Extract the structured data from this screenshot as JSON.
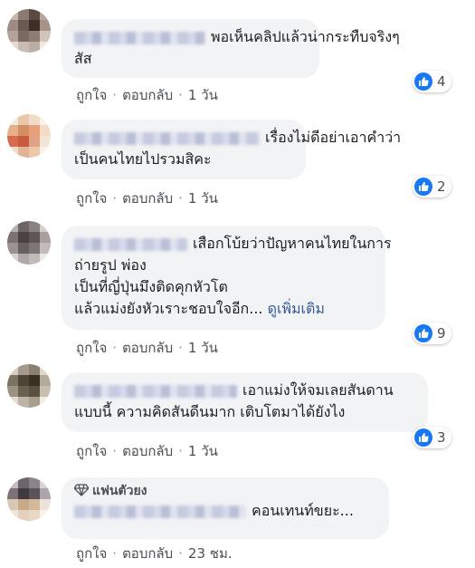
{
  "colors": {
    "like_blue": "#1877f2",
    "bubble_bg": "#f2f3f5",
    "link": "#385898"
  },
  "comments": [
    {
      "line1": "พอเห็นคลิปแล้วน่ากระทืบจริงๆ",
      "line2": "สัส",
      "like": "ถูกใจ",
      "reply": "ตอบกลับ",
      "time": "1 วัน",
      "reactions": "4",
      "avatar": [
        "#c8b8ac",
        "#8a7a72",
        "#5a4a44",
        "#b8a69c",
        "#9c8c84",
        "#6b5a52",
        "#3e2e28",
        "#a6948a",
        "#b4a296",
        "#7a6a62",
        "#8c7c72",
        "#d2c4ba",
        "#e4dad2",
        "#c8bcb4",
        "#bcaea4",
        "#f0e8e2"
      ]
    },
    {
      "line1": "เรื่องไม่ดีอย่าเอาคำว่า",
      "line2": "เป็นคนไทยไปรวมสิคะ",
      "like": "ถูกใจ",
      "reply": "ตอบกลับ",
      "time": "1 วัน",
      "reactions": "2",
      "avatar": [
        "#f4e8dc",
        "#e8c8a8",
        "#f0dcc8",
        "#faf2ea",
        "#e4b08a",
        "#d48e64",
        "#e8a07a",
        "#f2dcc6",
        "#d86a4e",
        "#c85a40",
        "#e0a282",
        "#f4e4d4",
        "#f2dac4",
        "#e0b496",
        "#ecc8aa",
        "#faf0e6"
      ]
    },
    {
      "line1": "เสือกโบ้ยว่าปัญหาคนไทยในการ",
      "line2": "ถ่ายรูป พ่อง",
      "line3": "เป็นที่ญี่ปุ่นมึงติดคุกหัวโต",
      "line4": "แล้วแม่งยังหัวเราะชอบใจอีก...",
      "see_more": "ดูเพิ่มเติม",
      "like": "ถูกใจ",
      "reply": "ตอบกลับ",
      "time": "1 วัน",
      "reactions": "9",
      "avatar": [
        "#b8b0ae",
        "#6e6664",
        "#8a8280",
        "#d4ceca",
        "#7a7270",
        "#4a4240",
        "#5e5654",
        "#a8a09e",
        "#9a9290",
        "#686060",
        "#7e7674",
        "#c4bcba",
        "#d8d2d0",
        "#b0a8a6",
        "#c2bab8",
        "#ece8e6"
      ]
    },
    {
      "line1": "เอาแม่งให้จมเลยสันดาน",
      "line2": "แบบนี้ ความคิดสันดีนมาก เติบโตมาได้ยังไง",
      "like": "ถูกใจ",
      "reply": "ตอบกลับ",
      "time": "1 วัน",
      "reactions": "3",
      "avatar": [
        "#d8d0c4",
        "#a49a8c",
        "#8a8070",
        "#e0d8cc",
        "#7c7262",
        "#4e4434",
        "#3a3022",
        "#b4aa9a",
        "#9c9282",
        "#6a6050",
        "#5a5040",
        "#c8beb0",
        "#e4dcd0",
        "#beb4a6",
        "#a89e90",
        "#f2ece4"
      ]
    },
    {
      "badge": "แฟนตัวยง",
      "line1": "คอนเทนท์ขยะ...",
      "like": "ถูกใจ",
      "reply": "ตอบกลับ",
      "time": "23 ชม.",
      "avatar": [
        "#c4bcc0",
        "#6c6468",
        "#8c8488",
        "#d8d2d4",
        "#7a7276",
        "#3e3a40",
        "#5a5458",
        "#aca4a8",
        "#d8c8b4",
        "#c8a888",
        "#d4b898",
        "#ece2d8",
        "#f0e4d4",
        "#e4d0bc",
        "#e8d8c6",
        "#f8f2ec"
      ]
    }
  ]
}
